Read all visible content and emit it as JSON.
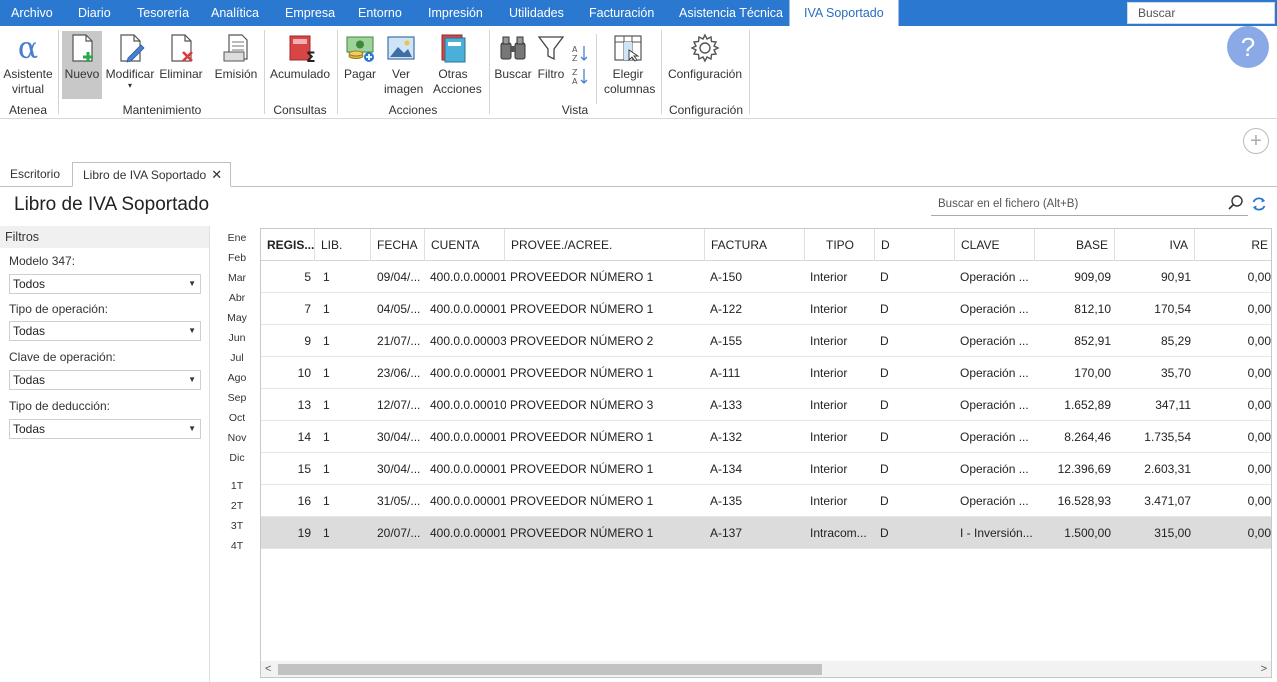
{
  "menu": {
    "items": [
      "Archivo",
      "Diario",
      "Tesorería",
      "Analítica",
      "Empresa",
      "Entorno",
      "Impresión",
      "Utilidades",
      "Facturación",
      "Asistencia Técnica"
    ],
    "active": "IVA Soportado",
    "search_placeholder": "Buscar"
  },
  "ribbon": {
    "asistente": "Asistente virtual",
    "nuevo": "Nuevo",
    "modificar": "Modificar",
    "eliminar": "Eliminar",
    "emision": "Emisión",
    "acumulado": "Acumulado",
    "pagar": "Pagar",
    "ver_imagen": "Ver imagen",
    "otras_acciones": "Otras Acciones",
    "buscar": "Buscar",
    "filtro": "Filtro",
    "elegir_columnas": "Elegir columnas",
    "configuracion": "Configuración",
    "groups": {
      "atenea": "Atenea",
      "mantenimiento": "Mantenimiento",
      "consultas": "Consultas",
      "acciones": "Acciones",
      "vista": "Vista",
      "configuracion": "Configuración"
    }
  },
  "tabs": {
    "escritorio": "Escritorio",
    "libro": "Libro de IVA Soportado"
  },
  "page_title": "Libro de IVA Soportado",
  "file_search_placeholder": "Buscar en el fichero (Alt+B)",
  "filters": {
    "title": "Filtros",
    "modelo_label": "Modelo 347:",
    "modelo_value": "Todos",
    "tipo_op_label": "Tipo de operación:",
    "tipo_op_value": "Todas",
    "clave_label": "Clave de operación:",
    "clave_value": "Todas",
    "deduccion_label": "Tipo de deducción:",
    "deduccion_value": "Todas"
  },
  "months": [
    "Ene",
    "Feb",
    "Mar",
    "Abr",
    "May",
    "Jun",
    "Jul",
    "Ago",
    "Sep",
    "Oct",
    "Nov",
    "Dic"
  ],
  "quarters": [
    "1T",
    "2T",
    "3T",
    "4T"
  ],
  "table": {
    "headers": [
      "REGIS...",
      "LIB.",
      "FECHA",
      "CUENTA",
      "PROVEE./ACREE.",
      "FACTURA",
      "TIPO",
      "D",
      "CLAVE",
      "BASE",
      "IVA",
      "RE"
    ],
    "rows": [
      [
        "5",
        "1",
        "09/04/...",
        "400.0.0.00001",
        "PROVEEDOR NÚMERO 1",
        "A-150",
        "Interior",
        "D",
        "Operación ...",
        "909,09",
        "90,91",
        "0,00"
      ],
      [
        "7",
        "1",
        "04/05/...",
        "400.0.0.00001",
        "PROVEEDOR NÚMERO 1",
        "A-122",
        "Interior",
        "D",
        "Operación ...",
        "812,10",
        "170,54",
        "0,00"
      ],
      [
        "9",
        "1",
        "21/07/...",
        "400.0.0.00003",
        "PROVEEDOR NÚMERO 2",
        "A-155",
        "Interior",
        "D",
        "Operación ...",
        "852,91",
        "85,29",
        "0,00"
      ],
      [
        "10",
        "1",
        "23/06/...",
        "400.0.0.00001",
        "PROVEEDOR NÚMERO 1",
        "A-111",
        "Interior",
        "D",
        "Operación ...",
        "170,00",
        "35,70",
        "0,00"
      ],
      [
        "13",
        "1",
        "12/07/...",
        "400.0.0.00010",
        "PROVEEDOR NÚMERO 3",
        "A-133",
        "Interior",
        "D",
        "Operación ...",
        "1.652,89",
        "347,11",
        "0,00"
      ],
      [
        "14",
        "1",
        "30/04/...",
        "400.0.0.00001",
        "PROVEEDOR NÚMERO 1",
        "A-132",
        "Interior",
        "D",
        "Operación ...",
        "8.264,46",
        "1.735,54",
        "0,00"
      ],
      [
        "15",
        "1",
        "30/04/...",
        "400.0.0.00001",
        "PROVEEDOR NÚMERO 1",
        "A-134",
        "Interior",
        "D",
        "Operación ...",
        "12.396,69",
        "2.603,31",
        "0,00"
      ],
      [
        "16",
        "1",
        "31/05/...",
        "400.0.0.00001",
        "PROVEEDOR NÚMERO 1",
        "A-135",
        "Interior",
        "D",
        "Operación ...",
        "16.528,93",
        "3.471,07",
        "0,00"
      ],
      [
        "19",
        "1",
        "20/07/...",
        "400.0.0.00001",
        "PROVEEDOR NÚMERO 1",
        "A-137",
        "Intracom...",
        "D",
        "I - Inversión...",
        "1.500,00",
        "315,00",
        "0,00"
      ]
    ]
  }
}
